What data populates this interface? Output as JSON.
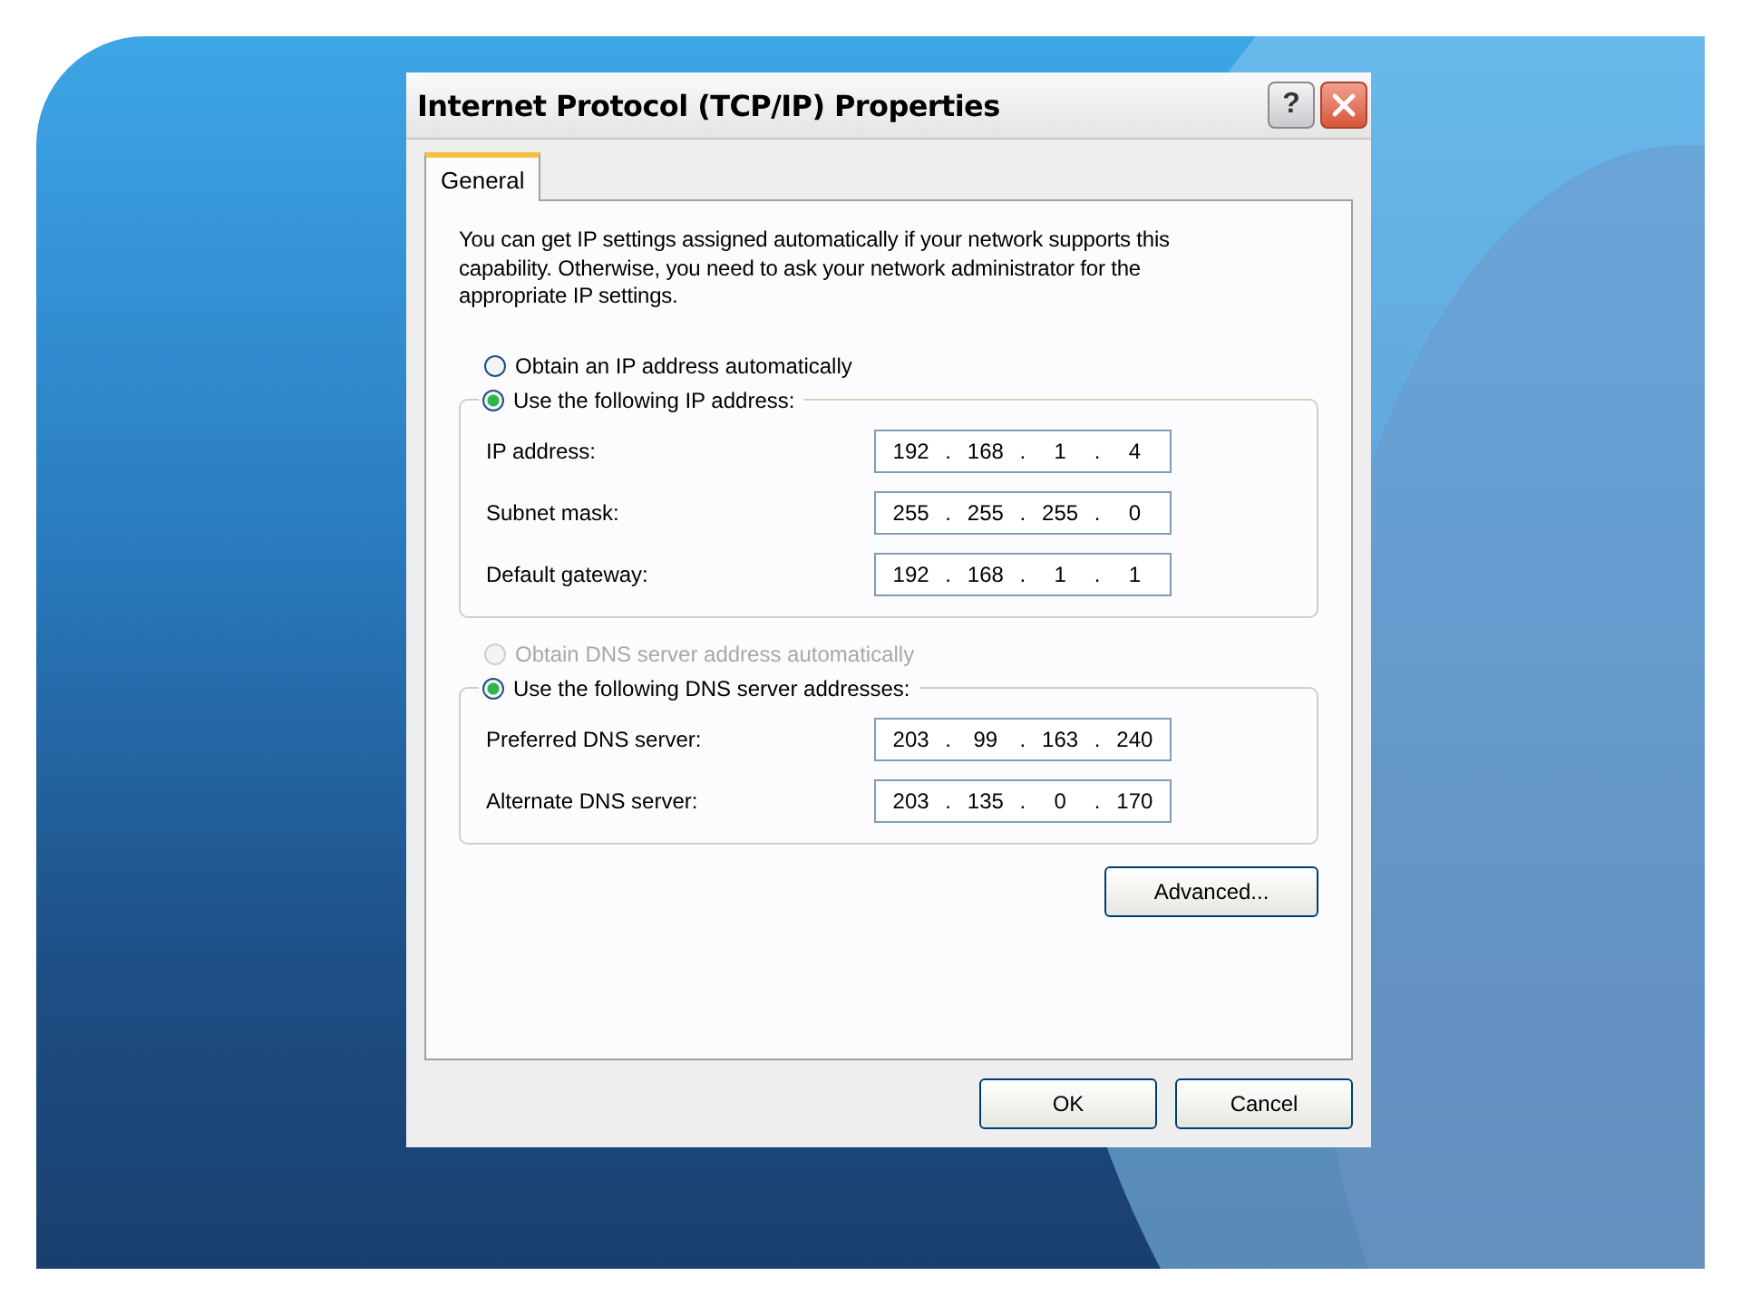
{
  "window": {
    "title": "Internet Protocol (TCP/IP) Properties",
    "controls": [
      {
        "kind": "help",
        "label": "?"
      },
      {
        "kind": "close"
      }
    ]
  },
  "tabs": [
    {
      "label": "General",
      "selected": true
    }
  ],
  "intro": "You can get IP settings assigned automatically if your network supports this capability. Otherwise, you need to ask your network administrator for the appropriate IP settings.",
  "ip_options": [
    {
      "label": "Obtain an IP address automatically",
      "selected": false,
      "disabled": false
    },
    {
      "label": "Use the following IP address:",
      "selected": true,
      "disabled": false
    }
  ],
  "ip_fields": [
    {
      "label": "IP address:",
      "octets": [
        "192",
        "168",
        "1",
        "4"
      ]
    },
    {
      "label": "Subnet mask:",
      "octets": [
        "255",
        "255",
        "255",
        "0"
      ]
    },
    {
      "label": "Default gateway:",
      "octets": [
        "192",
        "168",
        "1",
        "1"
      ]
    }
  ],
  "dns_options": [
    {
      "label": "Obtain DNS server address automatically",
      "selected": false,
      "disabled": true
    },
    {
      "label": "Use the following DNS server addresses:",
      "selected": true,
      "disabled": false
    }
  ],
  "dns_fields": [
    {
      "label": "Preferred DNS server:",
      "octets": [
        "203",
        "99",
        "163",
        "240"
      ]
    },
    {
      "label": "Alternate DNS server:",
      "octets": [
        "203",
        "135",
        "0",
        "170"
      ]
    }
  ],
  "separator": ".",
  "advanced_button": "Advanced...",
  "buttons": [
    "OK",
    "Cancel"
  ]
}
